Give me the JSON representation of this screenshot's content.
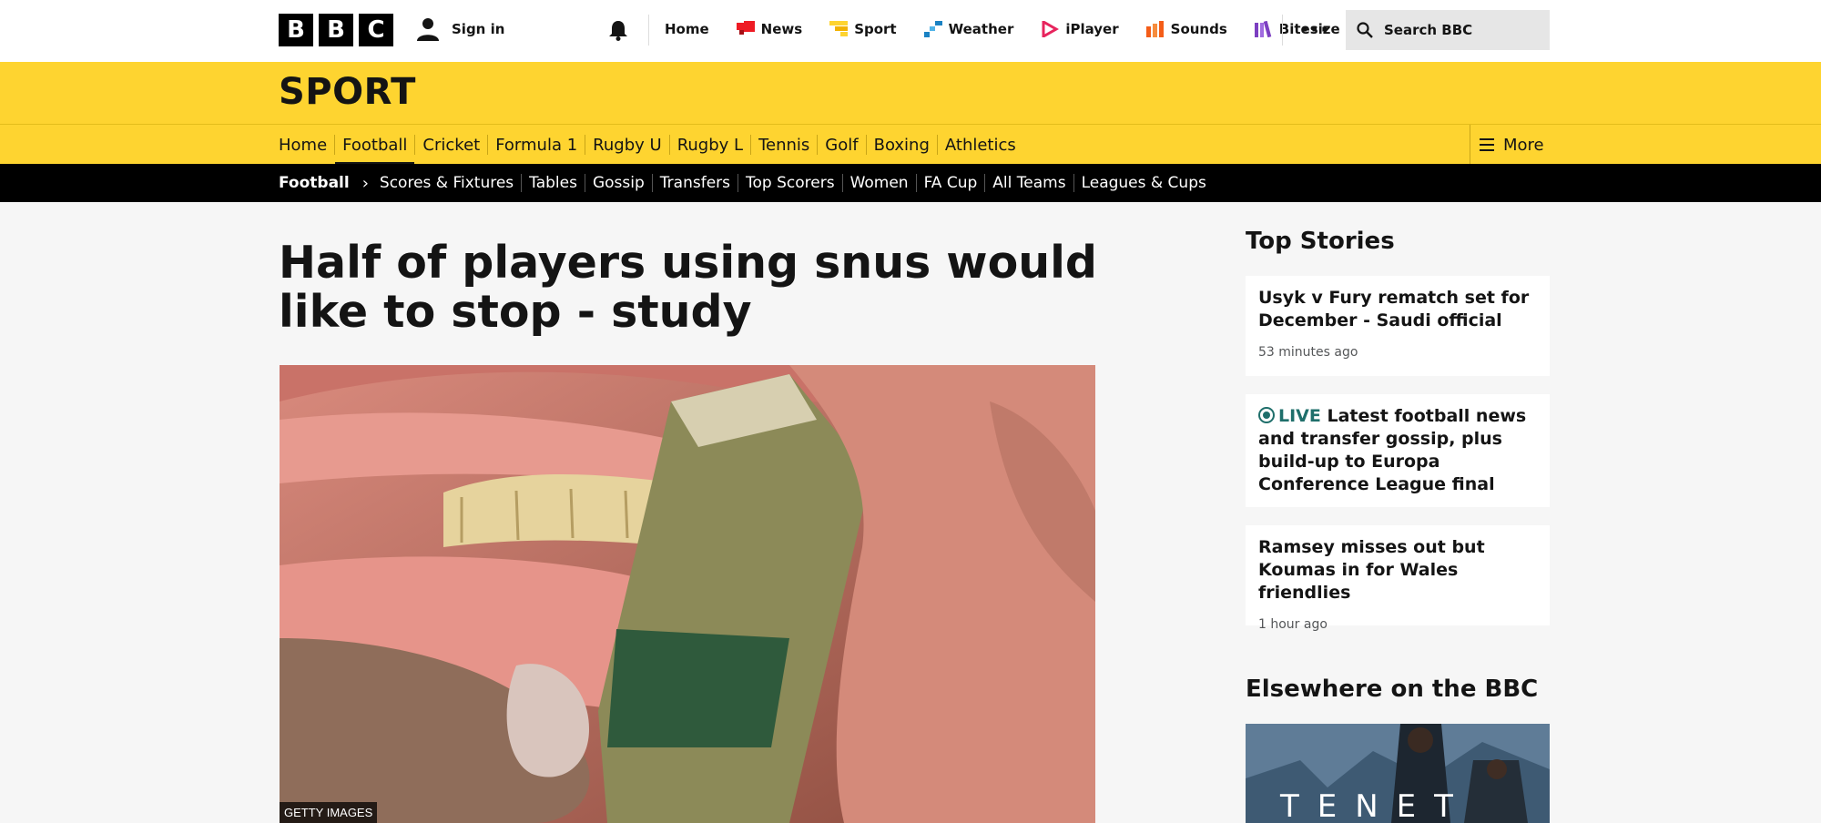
{
  "header": {
    "logo_letters": [
      "B",
      "B",
      "C"
    ],
    "sign_in": "Sign in",
    "nav": [
      {
        "label": "Home",
        "icon": "none"
      },
      {
        "label": "News",
        "icon": "news-icon",
        "color": "#ee1b24"
      },
      {
        "label": "Sport",
        "icon": "sport-icon",
        "color": "#fed430"
      },
      {
        "label": "Weather",
        "icon": "weather-icon",
        "color": "#1a82c3"
      },
      {
        "label": "iPlayer",
        "icon": "iplayer-icon",
        "color": "#e7245d"
      },
      {
        "label": "Sounds",
        "icon": "sounds-icon",
        "color": "#f45d18"
      },
      {
        "label": "Bitesize",
        "icon": "bitesize-icon",
        "color": "#7c3fc1"
      }
    ],
    "search_placeholder": "Search BBC"
  },
  "sport": {
    "title": "SPORT",
    "nav": [
      "Home",
      "Football",
      "Cricket",
      "Formula 1",
      "Rugby U",
      "Rugby L",
      "Tennis",
      "Golf",
      "Boxing",
      "Athletics"
    ],
    "active": "Football",
    "more": "More"
  },
  "subnav": {
    "section": "Football",
    "links": [
      "Scores & Fixtures",
      "Tables",
      "Gossip",
      "Transfers",
      "Top Scorers",
      "Women",
      "FA Cup",
      "All Teams",
      "Leagues & Cups"
    ]
  },
  "article": {
    "headline": "Half of players using snus would like to stop - study",
    "image_credit": "GETTY IMAGES"
  },
  "sidebar": {
    "top_stories_title": "Top Stories",
    "stories": [
      {
        "title": "Usyk v Fury rematch set for December - Saudi official",
        "time": "53 minutes ago"
      },
      {
        "live_label": "LIVE",
        "title": "Latest football news and transfer gossip, plus build-up to Europa Conference League final"
      },
      {
        "title": "Ramsey misses out but Koumas in for Wales friendlies",
        "time": "1 hour ago"
      }
    ],
    "elsewhere_title": "Elsewhere on the BBC",
    "promo_word": "TENET"
  }
}
